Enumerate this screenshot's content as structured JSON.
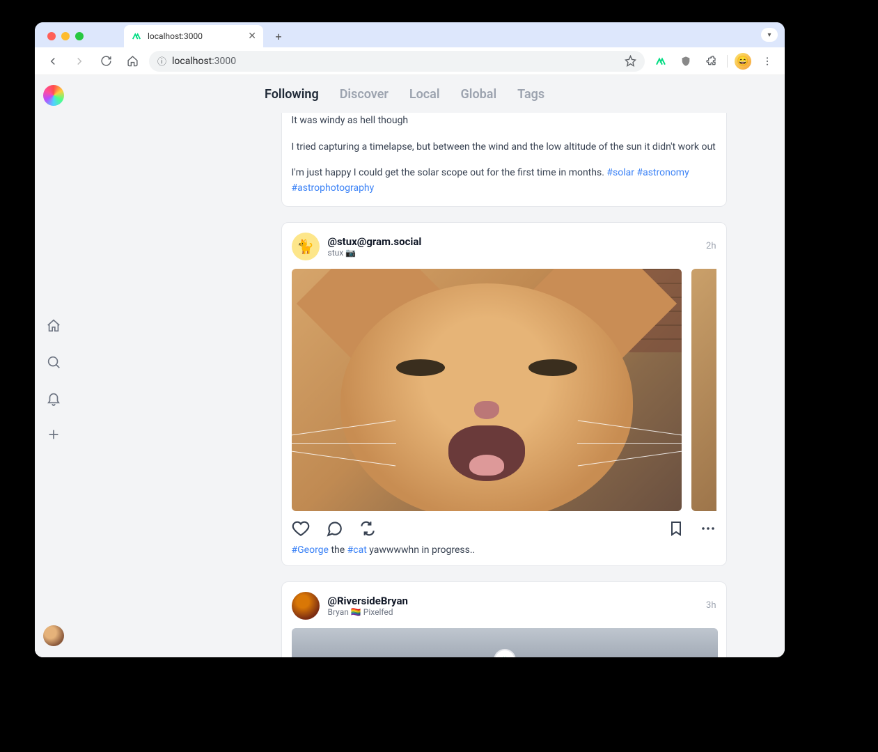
{
  "browser": {
    "tab_title": "localhost:3000",
    "url_host": "localhost",
    "url_rest": ":3000"
  },
  "nav_tabs": {
    "following": "Following",
    "discover": "Discover",
    "local": "Local",
    "global": "Global",
    "tags": "Tags"
  },
  "post0": {
    "line1": "It was windy as hell though",
    "line2": "I tried capturing a timelapse, but between the wind and the low altitude of the sun it didn't work out",
    "line3_a": "I'm just happy I could get the solar scope out for the first time in months. ",
    "tag_solar": "#solar",
    "tag_astronomy": "#astronomy",
    "tag_astrophoto": "#astrophotography"
  },
  "post1": {
    "handle": "@stux@gram.social",
    "subname": "stux 📷",
    "time": "2h",
    "caption_tag1": "#George",
    "caption_mid": " the ",
    "caption_tag2": "#cat",
    "caption_rest": " yawwwwhn in progress.."
  },
  "post2": {
    "handle": "@RiversideBryan",
    "subname": "Bryan 🏳️‍🌈 Pixelfed",
    "time": "3h"
  }
}
